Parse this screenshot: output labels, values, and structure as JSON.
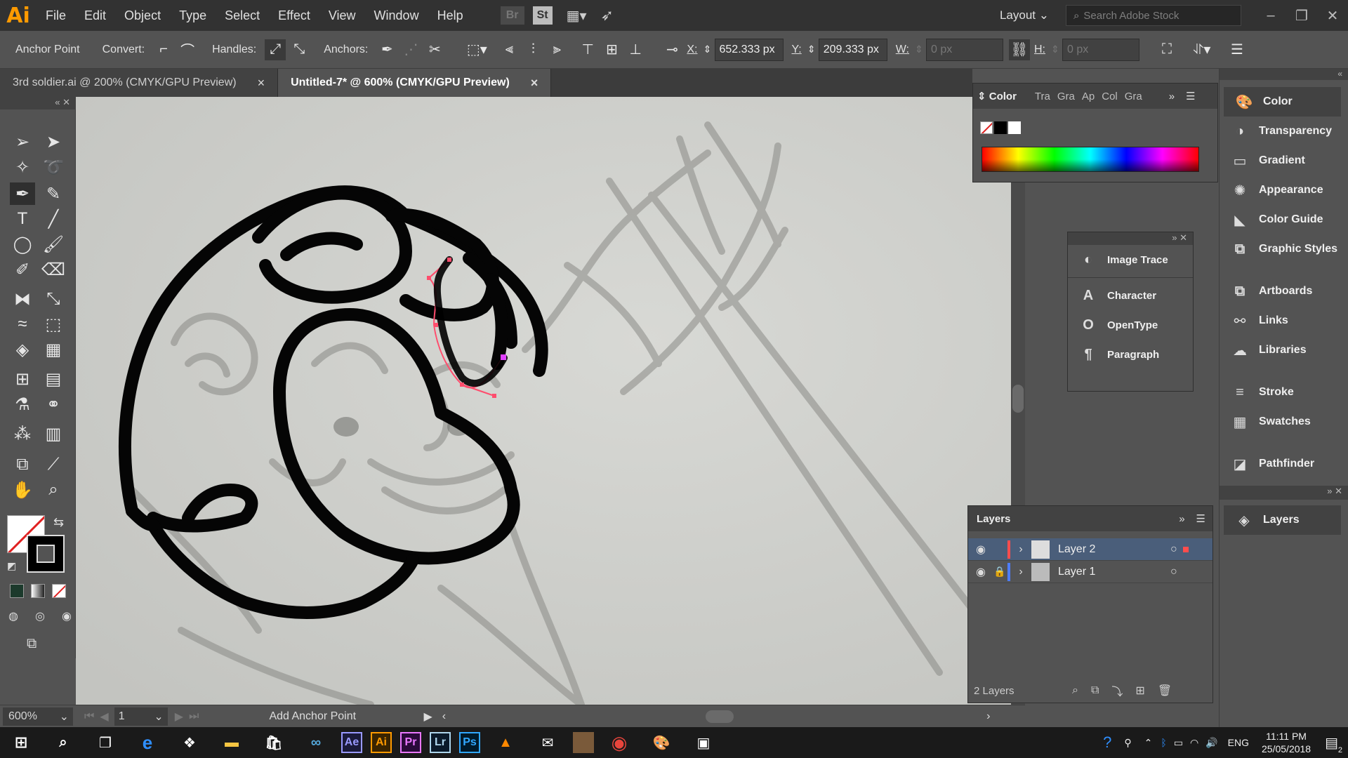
{
  "app": {
    "logo": "Ai"
  },
  "menu": [
    "File",
    "Edit",
    "Object",
    "Type",
    "Select",
    "Effect",
    "View",
    "Window",
    "Help"
  ],
  "menu_icons": {
    "bridge": "Br",
    "stock": "St"
  },
  "workspace": {
    "label": "Layout",
    "search_placeholder": "Search Adobe Stock"
  },
  "control": {
    "tool_name": "Anchor Point",
    "convert_label": "Convert:",
    "handles_label": "Handles:",
    "anchors_label": "Anchors:",
    "x_label": "X:",
    "x_value": "652.333 px",
    "y_label": "Y:",
    "y_value": "209.333 px",
    "w_label": "W:",
    "w_value": "0 px",
    "h_label": "H:",
    "h_value": "0 px"
  },
  "tabs": [
    {
      "label": "3rd soldier.ai @ 200% (CMYK/GPU Preview)",
      "close": "×"
    },
    {
      "label": "Untitled-7* @ 600% (CMYK/GPU Preview)",
      "close": "×"
    }
  ],
  "status": {
    "zoom": "600%",
    "artboard": "1",
    "tool_hint": "Add Anchor Point"
  },
  "color_panel": {
    "title": "Color",
    "other_tabs": [
      "Tra",
      "Gra",
      "Ap",
      "Col",
      "Gra"
    ]
  },
  "float_panel": {
    "items": [
      "Image Trace",
      "Character",
      "OpenType",
      "Paragraph"
    ]
  },
  "layers_panel": {
    "title": "Layers",
    "count": "2 Layers",
    "rows": [
      {
        "name": "Layer 2",
        "color": "#ff4d4d",
        "selected": true
      },
      {
        "name": "Layer 1",
        "color": "#4d7dff",
        "selected": false
      }
    ]
  },
  "dock": {
    "group1": [
      "Color",
      "Transparency",
      "Gradient",
      "Appearance",
      "Color Guide",
      "Graphic Styles"
    ],
    "group2": [
      "Artboards",
      "Links",
      "Libraries"
    ],
    "group3": [
      "Stroke",
      "Swatches"
    ],
    "group4": [
      "Pathfinder"
    ],
    "group5": [
      "Layers"
    ]
  },
  "taskbar": {
    "apps": [
      "Ae",
      "Ai",
      "Pr",
      "Lr",
      "Ps"
    ],
    "lang": "ENG",
    "time": "11:11 PM",
    "date": "25/05/2018",
    "notifications": "2"
  },
  "colors": {
    "accent_ai": "#ff9a00",
    "selection": "#ff4d6d",
    "ae": "#9999ff",
    "pr": "#ea77ff",
    "lr": "#add5ec",
    "ps": "#31a8ff"
  }
}
